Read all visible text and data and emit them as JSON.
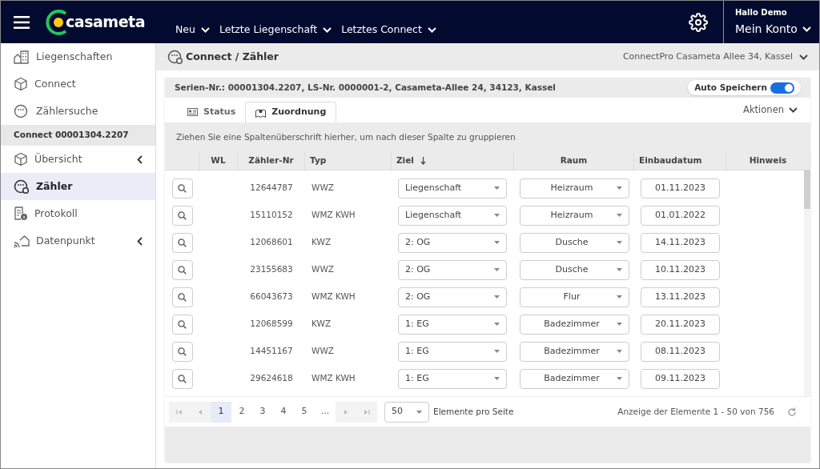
{
  "header": {
    "logo": "casameta",
    "nav": [
      {
        "label": "Neu"
      },
      {
        "label": "Letzte Liegenschaft"
      },
      {
        "label": "Letztes Connect"
      }
    ],
    "greeting": "Hallo Demo",
    "account": "Mein Konto"
  },
  "sidebar": {
    "items": [
      {
        "label": "Liegenschaften",
        "kind": "buildings",
        "selected": false,
        "submenu": false
      },
      {
        "label": "Connect",
        "kind": "cube",
        "selected": false,
        "submenu": false
      },
      {
        "label": "Zählersuche",
        "kind": "meter",
        "selected": false,
        "submenu": false
      }
    ],
    "section_title": "Connect 00001304.2207",
    "section_items": [
      {
        "label": "Übersicht",
        "kind": "cube",
        "selected": false,
        "submenu": true
      },
      {
        "label": "Zähler",
        "kind": "meter",
        "selected": true,
        "submenu": false
      },
      {
        "label": "Protokoll",
        "kind": "log",
        "selected": false,
        "submenu": false
      },
      {
        "label": "Datenpunkt",
        "kind": "datapoint",
        "selected": false,
        "submenu": true
      }
    ]
  },
  "page": {
    "breadcrumb": "Connect / Zähler",
    "context": "ConnectPro Casameta Allee 34, Kassel"
  },
  "card": {
    "info": "Serien-Nr.: 00001304.2207, LS-Nr. 0000001-2, Casameta-Allee 24, 34123, Kassel",
    "auto_save": {
      "label": "Auto Speichern",
      "on": true
    },
    "tabs": [
      {
        "label": "Status",
        "selected": false
      },
      {
        "label": "Zuordnung",
        "selected": true
      }
    ],
    "actions": "Aktionen",
    "group_hint": "Ziehen Sie eine Spaltenüberschrift hierher, um nach dieser Spalte zu gruppieren",
    "columns": [
      {
        "label": "WL",
        "sorted": false
      },
      {
        "label": "Zähler-Nr",
        "sorted": false
      },
      {
        "label": "Typ",
        "sorted": false
      },
      {
        "label": "Ziel",
        "sorted": true
      },
      {
        "label": "Raum",
        "sorted": false
      },
      {
        "label": "Einbaudatum",
        "sorted": false
      },
      {
        "label": "Hinweis",
        "sorted": false
      }
    ],
    "rows": [
      {
        "number": "12644787",
        "type": "WWZ",
        "ziel": "Liegenschaft",
        "raum": "Heizraum",
        "date": "01.11.2023"
      },
      {
        "number": "15110152",
        "type": "WMZ KWH",
        "ziel": "Liegenschaft",
        "raum": "Heizraum",
        "date": "01.01.2022"
      },
      {
        "number": "12068601",
        "type": "KWZ",
        "ziel": "2: OG",
        "raum": "Dusche",
        "date": "14.11.2023"
      },
      {
        "number": "23155683",
        "type": "WWZ",
        "ziel": "2: OG",
        "raum": "Dusche",
        "date": "10.11.2023"
      },
      {
        "number": "66043673",
        "type": "WMZ KWH",
        "ziel": "2: OG",
        "raum": "Flur",
        "date": "13.11.2023"
      },
      {
        "number": "12068599",
        "type": "KWZ",
        "ziel": "1: EG",
        "raum": "Badezimmer",
        "date": "20.11.2023"
      },
      {
        "number": "14451167",
        "type": "WWZ",
        "ziel": "1: EG",
        "raum": "Badezimmer",
        "date": "08.11.2023"
      },
      {
        "number": "29624618",
        "type": "WMZ KWH",
        "ziel": "1: EG",
        "raum": "Badezimmer",
        "date": "09.11.2023"
      }
    ],
    "pagination": {
      "pages": [
        {
          "label": "1",
          "selected": true
        },
        {
          "label": "2",
          "selected": false
        },
        {
          "label": "3",
          "selected": false
        },
        {
          "label": "4",
          "selected": false
        },
        {
          "label": "5",
          "selected": false
        },
        {
          "label": "...",
          "selected": false
        }
      ],
      "page_size": "50",
      "page_size_label": "Elemente pro Seite",
      "summary": "Anzeige der Elemente 1 - 50 von 756"
    }
  }
}
